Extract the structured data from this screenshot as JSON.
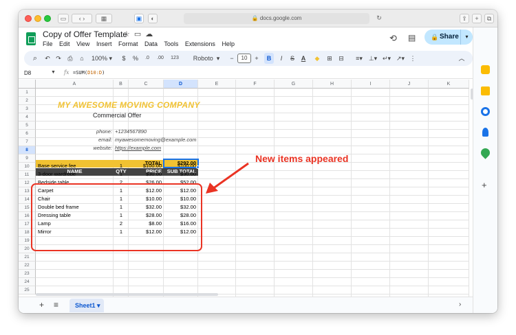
{
  "browser": {
    "url": "docs.google.com",
    "back_icon": "chevron-left-icon",
    "forward_icon": "chevron-right-icon"
  },
  "app": {
    "title": "Copy of Offer Template",
    "menu": [
      "File",
      "Edit",
      "View",
      "Insert",
      "Format",
      "Data",
      "Tools",
      "Extensions",
      "Help"
    ],
    "share_label": "Share"
  },
  "toolbar": {
    "zoom": "100%",
    "currency": "$",
    "percent": "%",
    "dec_less": ".0",
    "dec_more": ".00",
    "number_format": "123",
    "font": "Roboto",
    "font_size": "10",
    "bold": "B",
    "italic": "I"
  },
  "formula_bar": {
    "cell_ref": "D8",
    "formula_prefix": "=SUM(",
    "formula_range": "D10:D",
    "formula_suffix": ")"
  },
  "columns": [
    "A",
    "B",
    "C",
    "D",
    "E",
    "F",
    "G",
    "H",
    "I",
    "J",
    "K"
  ],
  "rows": [
    "1",
    "2",
    "3",
    "4",
    "5",
    "6",
    "7",
    "8",
    "9",
    "10",
    "11",
    "12",
    "13",
    "14",
    "15",
    "16",
    "17",
    "18",
    "19",
    "20",
    "21",
    "22",
    "23",
    "24",
    "25"
  ],
  "sheet": {
    "company": "MY AWESOME MOVING COMPANY",
    "subtitle": "Commercial Offer",
    "phone_label": "phone:",
    "phone": "+1234567890",
    "email_label": "email:",
    "email": "myawesomemoving@example.com",
    "website_label": "website:",
    "website": "https://example.com",
    "total_label": "TOTAL",
    "total_value": "$292.00",
    "headers": [
      "NAME",
      "QTY",
      "PRICE",
      "SUB TOTAL"
    ],
    "items": [
      {
        "name": "Base service fee",
        "qty": "1",
        "price": "$100.00",
        "subtotal": "$100.00"
      },
      {
        "name": "3-door wardrobe",
        "qty": "1",
        "price": "$30.00",
        "subtotal": "$30.00"
      },
      {
        "name": "Bedside table",
        "qty": "2",
        "price": "$26.00",
        "subtotal": "$52.00"
      },
      {
        "name": "Carpet",
        "qty": "1",
        "price": "$12.00",
        "subtotal": "$12.00"
      },
      {
        "name": "Chair",
        "qty": "1",
        "price": "$10.00",
        "subtotal": "$10.00"
      },
      {
        "name": "Double bed frame",
        "qty": "1",
        "price": "$32.00",
        "subtotal": "$32.00"
      },
      {
        "name": "Dressing table",
        "qty": "1",
        "price": "$28.00",
        "subtotal": "$28.00"
      },
      {
        "name": "Lamp",
        "qty": "2",
        "price": "$8.00",
        "subtotal": "$16.00"
      },
      {
        "name": "Mirror",
        "qty": "1",
        "price": "$12.00",
        "subtotal": "$12.00"
      }
    ]
  },
  "annotation": {
    "text": "New items appeared",
    "color": "#ea3323"
  },
  "tabs": {
    "sheet_name": "Sheet1"
  },
  "colors": {
    "brand_green": "#0f9d58",
    "header_yellow": "#f1c232",
    "header_dark": "#434343",
    "selection_blue": "#1a73e8",
    "share_bg": "#c2e7ff"
  }
}
